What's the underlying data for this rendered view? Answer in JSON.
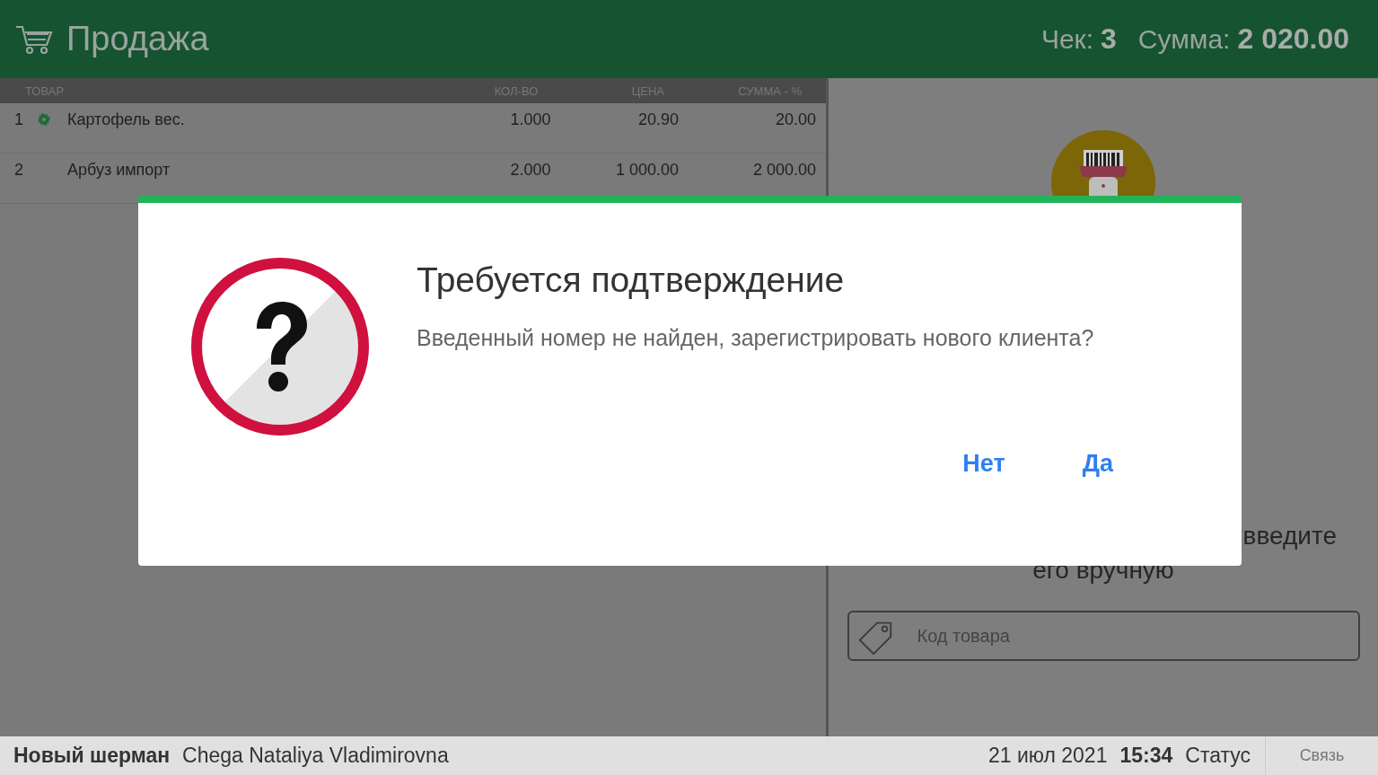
{
  "header": {
    "title": "Продажа",
    "check_label": "Чек:",
    "check_number": "3",
    "sum_label": "Сумма:",
    "sum_value": "2 020.00"
  },
  "table": {
    "columns": [
      "ТОВАР",
      "КОЛ-ВО",
      "ЦЕНА",
      "СУММА - %"
    ],
    "rows": [
      {
        "index": "1",
        "weighted": true,
        "name": "Картофель вес.",
        "qty": "1.000",
        "price": "20.90",
        "sum": "20.00"
      },
      {
        "index": "2",
        "weighted": false,
        "name": "Арбуз импорт",
        "qty": "2.000",
        "price": "1 000.00",
        "sum": "2 000.00"
      }
    ]
  },
  "scan_panel": {
    "hint_lines": [
      "введите",
      "его вручную"
    ],
    "input": {
      "placeholder": "Код товара"
    }
  },
  "dialog": {
    "title": "Требуется подтверждение",
    "message": "Введенный номер не найден, зарегистрировать нового клиента?",
    "buttons": [
      "Нет",
      "Да"
    ]
  },
  "status_bar": {
    "shift": "Новый шерман",
    "cashier": "Chega Nataliya Vladimirovna",
    "date": "21 июл 2021",
    "time": "15:34",
    "status": "Статус",
    "connection": "Связь"
  }
}
